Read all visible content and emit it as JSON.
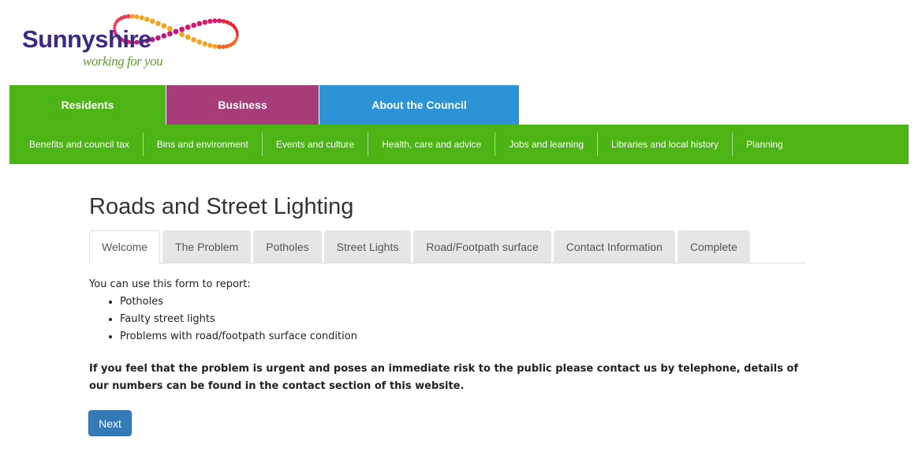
{
  "brand": {
    "name": "Sunnyshire",
    "tagline": "working for you",
    "logo_icon": "dotted-loop-logo",
    "colors": {
      "green": "#4cb515",
      "purple": "#a63d79",
      "blue": "#2b93d6",
      "brand_purple": "#3d2a86"
    }
  },
  "top_nav": [
    {
      "label": "Residents"
    },
    {
      "label": "Business"
    },
    {
      "label": "About the Council"
    }
  ],
  "sub_nav": [
    {
      "label": "Benefits and council tax"
    },
    {
      "label": "Bins and environment"
    },
    {
      "label": "Events and culture"
    },
    {
      "label": "Health, care and advice"
    },
    {
      "label": "Jobs and learning"
    },
    {
      "label": "Libraries and local history"
    },
    {
      "label": "Planning"
    }
  ],
  "page": {
    "title": "Roads and Street Lighting",
    "tabs": [
      {
        "label": "Welcome",
        "active": true
      },
      {
        "label": "The Problem"
      },
      {
        "label": "Potholes"
      },
      {
        "label": "Street Lights"
      },
      {
        "label": "Road/Footpath surface"
      },
      {
        "label": "Contact Information"
      },
      {
        "label": "Complete"
      }
    ],
    "intro": "You can use this form to report:",
    "list": [
      "Potholes",
      "Faulty street lights",
      "Problems with  road/footpath surface condition"
    ],
    "urgent": "If you feel that the problem is urgent and poses an immediate risk to the public please contact us by telephone, details of our numbers can be found in the contact section of this website.",
    "next_label": "Next"
  }
}
